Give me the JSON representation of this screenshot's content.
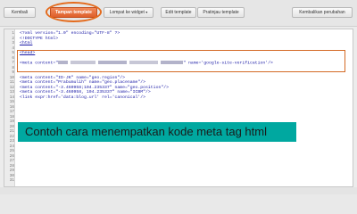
{
  "toolbar": {
    "back": "Kembali",
    "template_preview": "Tampan template",
    "jump_widget": "Lompat ke widget",
    "edit_template": "Edit template",
    "preview_template": "Pratinjau template",
    "revert_changes": "Kembalikan perubahan",
    "caret": "▾"
  },
  "line_numbers": [
    "1",
    "2",
    "3",
    "4",
    "5",
    "6",
    "7",
    "8",
    "9",
    "10",
    "11",
    "12",
    "13",
    "14",
    "15",
    "16",
    "17",
    "18",
    "19",
    "20",
    "21",
    "22",
    "23",
    "24",
    "25",
    "26",
    "27",
    "28",
    "29",
    "30",
    "31"
  ],
  "code": {
    "l1": "<?xml version=\"1.0\" encoding=\"UTF-8\" ?>",
    "l2": "<!DOCTYPE html>",
    "l3": "<html",
    "l4": "<head>",
    "l5a": "<meta content=\"",
    "l5b": "\" name='google-site-verification'/>",
    "l7": "<meta content=\"ID-JK\" name=\"geo.region\"/>",
    "l8": "<meta content=\"Prabumulih\" name=\"geo.placename\"/>",
    "l9": "<meta content=\"-3.460958;104.235337\" name=\"geo.position\"/>",
    "l10": "<meta content=\"-3.460958, 104.235337\" name=\"ICBM\"/>",
    "l11": "<link expr:href='data:blog.url' rel='canonical'/>"
  },
  "banner": "Contoh cara menempatkan kode meta tag html"
}
